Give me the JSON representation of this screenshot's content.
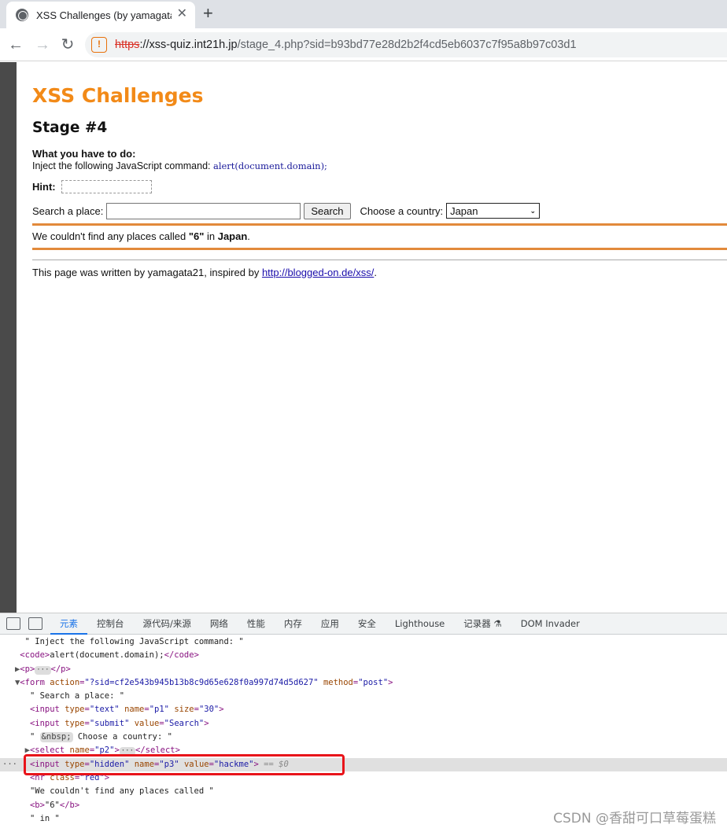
{
  "browser": {
    "tab_title": "XSS Challenges (by yamagata",
    "url_scheme": "https",
    "url_host": "://xss-quiz.int21h.jp",
    "url_path": "/stage_4.php?sid=b93bd77e28d2b2f4cd5eb6037c7f95a8b97c03d1",
    "icons": [
      "globe-icon",
      "close-icon",
      "plus-icon",
      "back-icon",
      "forward-icon",
      "reload-icon",
      "not-secure-icon"
    ]
  },
  "page": {
    "title": "XSS Challenges",
    "stage": "Stage #4",
    "todo_label": "What you have to do:",
    "inject_text": "Inject the following JavaScript command: ",
    "inject_code": "alert(document.domain);",
    "hint_label": "Hint:",
    "search_label": "Search a place:",
    "search_value": "",
    "search_button": "Search",
    "country_label": "Choose a country:",
    "country_selected": "Japan",
    "result_prefix": "We couldn't find any places called ",
    "result_query": "\"6\"",
    "result_mid": " in ",
    "result_country": "Japan",
    "result_suffix": ".",
    "footer_prefix": "This page was written by yamagata21, inspired by ",
    "footer_link": "http://blogged-on.de/xss/",
    "footer_suffix": "."
  },
  "devtools": {
    "tabs": [
      "元素",
      "控制台",
      "源代码/来源",
      "网络",
      "性能",
      "内存",
      "应用",
      "安全",
      "Lighthouse",
      "记录器 ⚗",
      "DOM Invader"
    ],
    "active_tab": "元素",
    "lines": {
      "l1": "\" Inject the following JavaScript command: \"",
      "l2_open": "<code>",
      "l2_text": "alert(document.domain);",
      "l2_close": "</code>",
      "l3_open": "<p>",
      "l3_close": "</p>",
      "l4_tag": "<form ",
      "l4_a1": "action",
      "l4_v1": "\"?sid=cf2e543b945b13b8c9d65e628f0a997d74d5d627\"",
      "l4_a2": "method",
      "l4_v2": "\"post\"",
      "l4_end": ">",
      "l5": "\" Search a place: \"",
      "l6_tag": "<input ",
      "l6_a1": "type",
      "l6_v1": "\"text\"",
      "l6_a2": "name",
      "l6_v2": "\"p1\"",
      "l6_a3": "size",
      "l6_v3": "\"30\"",
      "l7_tag": "<input ",
      "l7_a1": "type",
      "l7_v1": "\"submit\"",
      "l7_a2": "value",
      "l7_v2": "\"Search\"",
      "l8_pre": "\" ",
      "l8_nbsp": "&nbsp;",
      "l8_post": " Choose a country: \"",
      "l9_tag": "<select ",
      "l9_a1": "name",
      "l9_v1": "\"p2\"",
      "l9_close": "</select>",
      "l10_tag": "<input ",
      "l10_a1": "type",
      "l10_v1": "\"hidden\"",
      "l10_a2": "name",
      "l10_v2": "\"p3\"",
      "l10_a3": "value",
      "l10_v3": "\"hackme\"",
      "l10_dollar": "== $0",
      "l11_tag": "<hr ",
      "l11_a1": "class",
      "l11_v1": "\"red\"",
      "l12": "\"We couldn't find any places called \"",
      "l13_open": "<b>",
      "l13_text": "\"6\"",
      "l13_close": "</b>",
      "l14": "\" in \""
    }
  },
  "watermark": "CSDN @香甜可口草莓蛋糕"
}
